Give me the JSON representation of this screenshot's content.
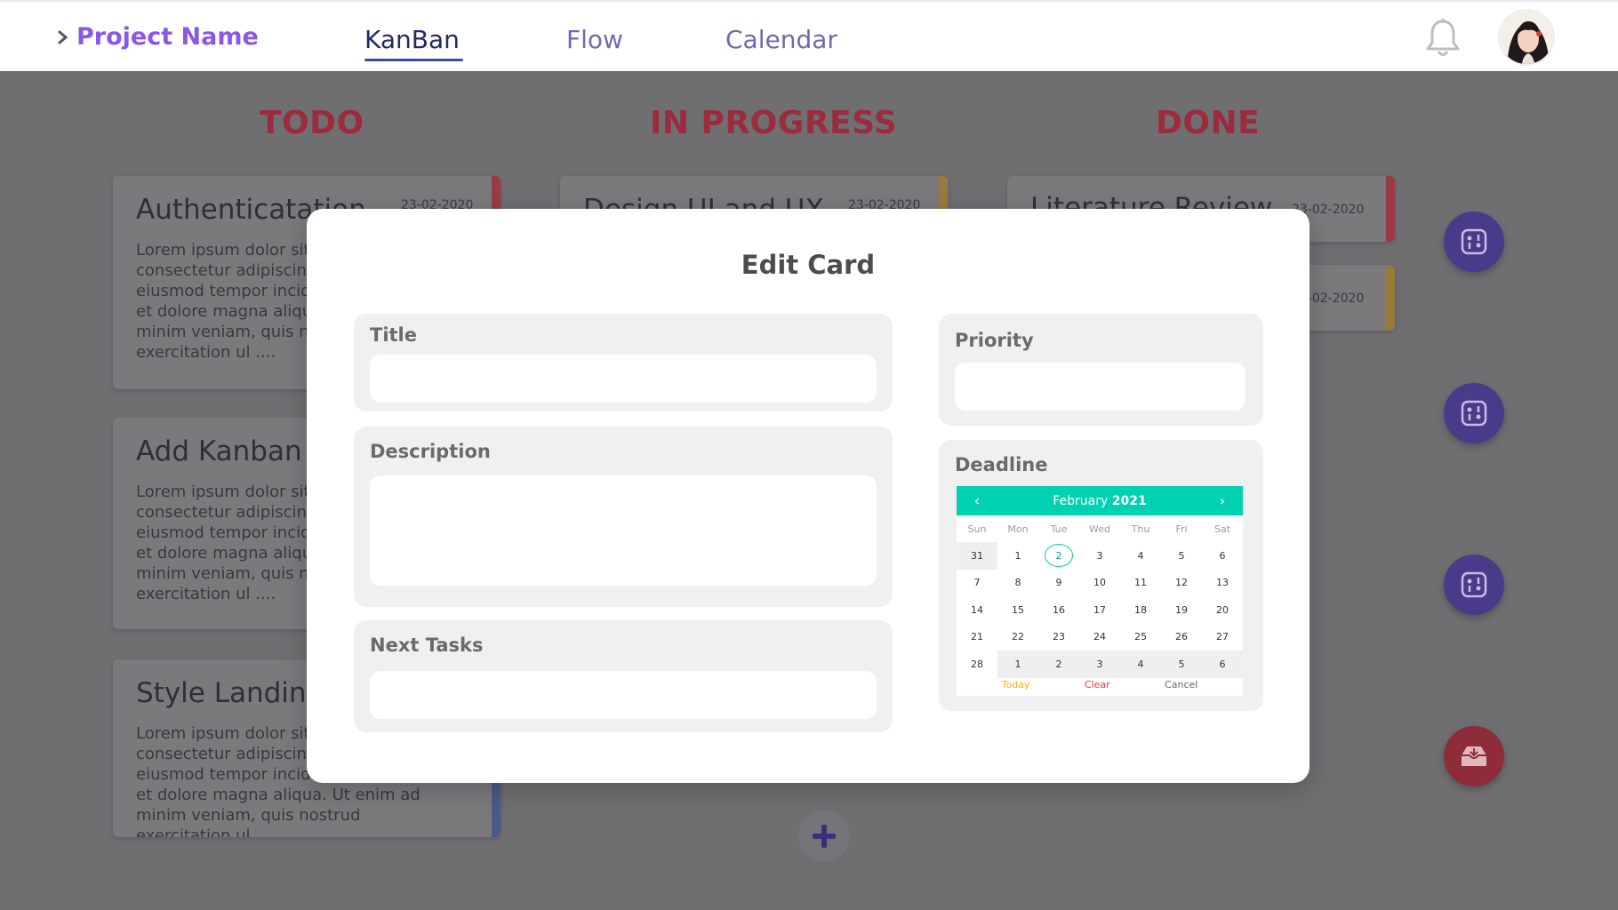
{
  "header": {
    "project_name": "Project Name",
    "tabs": [
      {
        "label": "KanBan",
        "active": true
      },
      {
        "label": "Flow",
        "active": false
      },
      {
        "label": "Calendar",
        "active": false
      }
    ]
  },
  "columns": [
    {
      "title": "TODO"
    },
    {
      "title": "IN PROGRESS"
    },
    {
      "title": "DONE"
    }
  ],
  "cards": {
    "todo": [
      {
        "title": "Authenticatation",
        "date": "23-02-2020",
        "desc": "Lorem ipsum dolor sit amet, consectetur adipiscing elit, sed do eiusmod tempor incididunt ut labore et dolore magna aliqua. Ut enim ad minim veniam, quis nostrud exercitation ul ...."
      },
      {
        "title": "Add Kanban",
        "desc": "Lorem ipsum dolor sit amet, consectetur adipiscing elit, sed do eiusmod tempor incididunt ut labore et dolore magna aliqua. Ut enim ad minim veniam, quis nostrud exercitation ul ...."
      },
      {
        "title": "Style Landing",
        "desc": "Lorem ipsum dolor sit amet, consectetur adipiscing elit, sed do eiusmod tempor incididunt ut labore et dolore magna aliqua. Ut enim ad minim veniam, quis nostrud exercitation ul ...."
      }
    ],
    "in_progress": [
      {
        "title": "Design UI and UX",
        "date": "23-02-2020"
      }
    ],
    "done": [
      {
        "title": "Literature Review",
        "date": "23-02-2020"
      },
      {
        "date": "23-02-2020"
      }
    ]
  },
  "modal": {
    "title": "Edit Card",
    "fields": {
      "title_label": "Title",
      "description_label": "Description",
      "next_tasks_label": "Next Tasks",
      "priority_label": "Priority",
      "deadline_label": "Deadline"
    },
    "values": {
      "title": "",
      "description": "",
      "next_tasks": "",
      "priority": ""
    }
  },
  "calendar": {
    "month": "February",
    "year": "2021",
    "prev_icon": "‹",
    "next_icon": "›",
    "weekdays": [
      "Sun",
      "Mon",
      "Tue",
      "Wed",
      "Thu",
      "Fri",
      "Sat"
    ],
    "days": [
      [
        "31",
        "1",
        "2",
        "3",
        "4",
        "5",
        "6"
      ],
      [
        "7",
        "8",
        "9",
        "10",
        "11",
        "12",
        "13"
      ],
      [
        "14",
        "15",
        "16",
        "17",
        "18",
        "19",
        "20"
      ],
      [
        "21",
        "22",
        "23",
        "24",
        "25",
        "26",
        "27"
      ],
      [
        "28",
        "1",
        "2",
        "3",
        "4",
        "5",
        "6"
      ]
    ],
    "selected": "2",
    "footer": {
      "today": "Today",
      "clear": "Clear",
      "cancel": "Cancel"
    },
    "colors": {
      "header": "#00d1b0",
      "today": "#f5b400",
      "clear": "#e53935",
      "cancel": "#666666"
    }
  },
  "colors": {
    "accent": "#8a57e8",
    "column_title": "#e0304f",
    "fab": "#5b3fb7",
    "fab_red": "#d33a4e"
  }
}
